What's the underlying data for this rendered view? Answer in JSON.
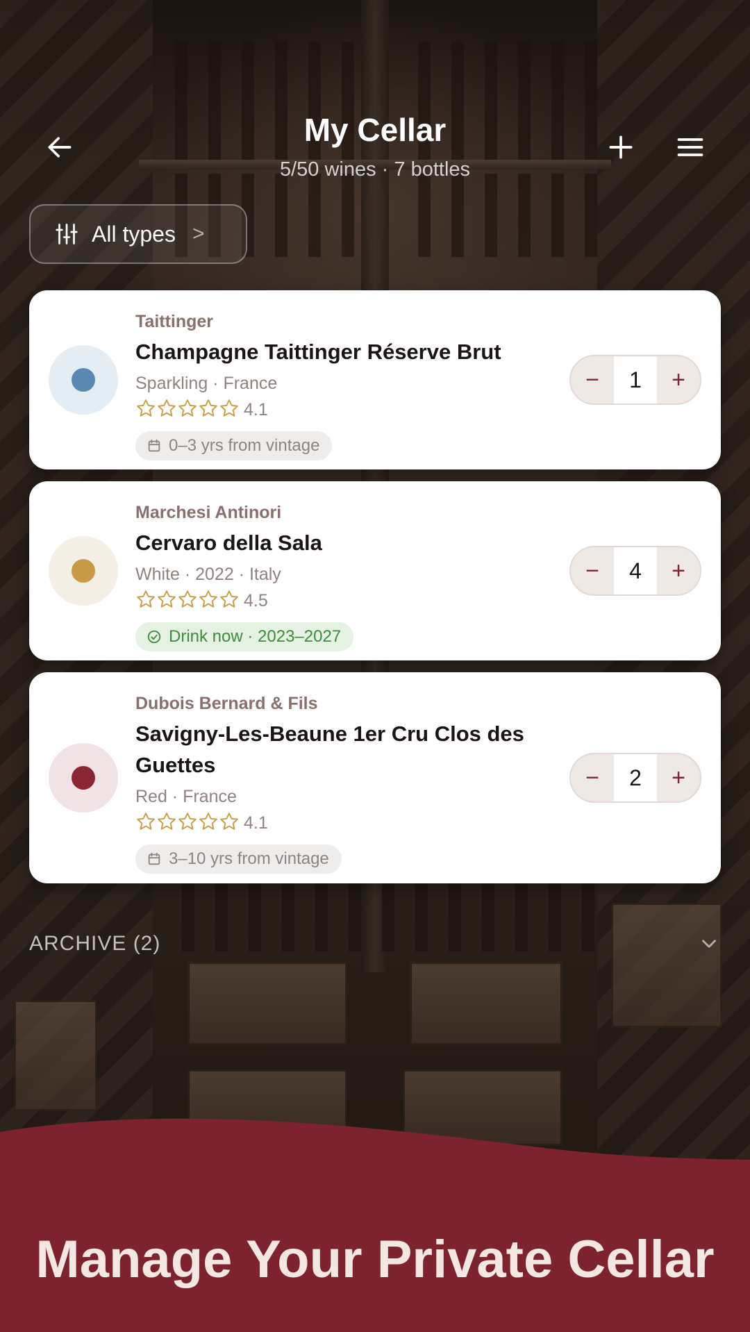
{
  "header": {
    "title": "My Cellar",
    "subtitle": "5/50 wines · 7 bottles",
    "back_icon": "arrow-left-icon",
    "add_icon": "plus-icon",
    "menu_icon": "hamburger-menu-icon"
  },
  "filter": {
    "label": "All types",
    "icon": "sliders-icon",
    "chevron": ">"
  },
  "wines": [
    {
      "producer": "Taittinger",
      "name": "Champagne Taittinger Réserve Brut",
      "meta": "Sparkling · France",
      "rating": "4.1",
      "rating_value": 4.1,
      "window": "0–3 yrs from vintage",
      "window_icon": "calendar-icon",
      "quantity": "1",
      "color": "#5b87b0",
      "color_bg": "#e4edf3"
    },
    {
      "producer": "Marchesi Antinori",
      "name": "Cervaro della Sala",
      "meta": "White · 2022 · Italy",
      "rating": "4.5",
      "rating_value": 4.5,
      "window": "Drink now · 2023–2027",
      "window_icon": "check-circle-icon",
      "quantity": "4",
      "color": "#c89a45",
      "color_bg": "#f3efe4"
    },
    {
      "producer": "Dubois Bernard & Fils",
      "name": "Savigny-Les-Beaune 1er Cru Clos des Guettes",
      "meta": "Red · France",
      "rating": "4.1",
      "rating_value": 4.1,
      "window": "3–10 yrs from vintage",
      "window_icon": "calendar-icon",
      "quantity": "2",
      "color": "#8a2634",
      "color_bg": "#f1e3e5"
    }
  ],
  "stepper": {
    "minus": "−",
    "plus": "+"
  },
  "archive": {
    "label": "ARCHIVE (2)",
    "icon": "chevron-down-icon"
  },
  "banner": {
    "text": "Manage Your Private Cellar",
    "color": "#7c232f"
  },
  "colors": {
    "accent": "#7d2632",
    "star": "#c8a24a"
  }
}
